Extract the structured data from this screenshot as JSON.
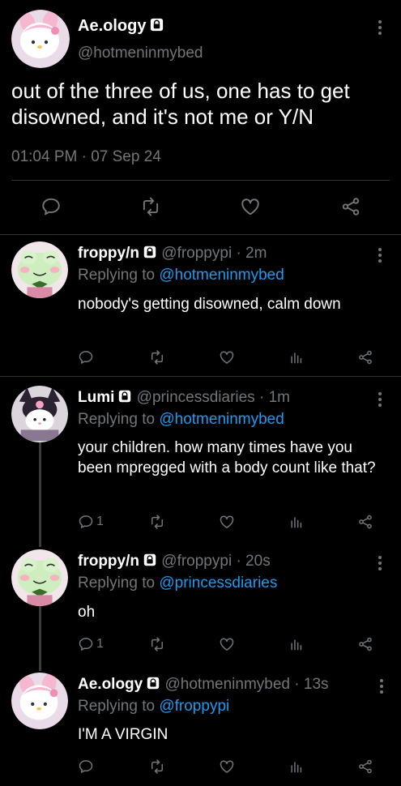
{
  "main_tweet": {
    "display_name": "Ae.ology",
    "handle": "@hotmeninmybed",
    "text": "out of the three of us, one has to get disowned, and it's not me or Y/N",
    "time": "01:04 PM",
    "separator": "·",
    "date": "07 Sep 24"
  },
  "replies": [
    {
      "display_name": "froppy/n",
      "handle": "@froppypi",
      "time": "· 2m",
      "replying_prefix": "Replying to",
      "replying_to": "@hotmeninmybed",
      "text": "nobody's getting disowned, calm down",
      "reply_count": ""
    },
    {
      "display_name": "Lumi",
      "handle": "@princessdiaries",
      "time": "· 1m",
      "replying_prefix": "Replying to",
      "replying_to": "@hotmeninmybed",
      "text": "your children. how many times have you been mpregged with a body count like that?",
      "reply_count": "1"
    },
    {
      "display_name": "froppy/n",
      "handle": "@froppypi",
      "time": "· 20s",
      "replying_prefix": "Replying to",
      "replying_to": "@princessdiaries",
      "text": "oh",
      "reply_count": "1"
    },
    {
      "display_name": "Ae.ology",
      "handle": "@hotmeninmybed",
      "time": "· 13s",
      "replying_prefix": "Replying to",
      "replying_to": "@froppypi",
      "text": "I'M A VIRGIN",
      "reply_count": ""
    }
  ],
  "icons": [
    "reply-icon",
    "retweet-icon",
    "like-icon",
    "analytics-icon",
    "share-icon",
    "lock-icon",
    "more-icon"
  ],
  "colors": {
    "background": "#000000",
    "link": "#1d9bf0",
    "muted": "#71767b",
    "divider": "#2f3336"
  }
}
